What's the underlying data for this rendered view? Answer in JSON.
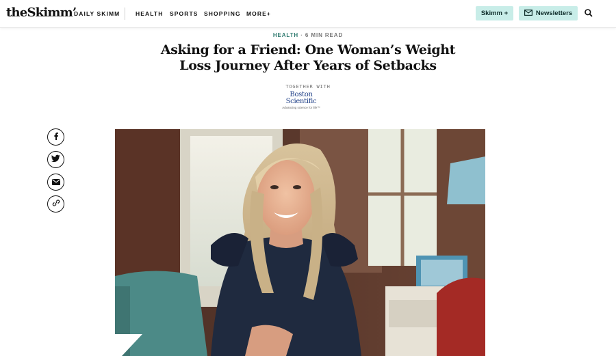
{
  "header": {
    "logo": "theSkimm’",
    "nav": [
      "DAILY SKIMM",
      "HEALTH",
      "SPORTS",
      "SHOPPING",
      "MORE+"
    ],
    "skimm_plus_label": "Skimm +",
    "newsletters_label": "Newsletters",
    "icons": {
      "search": "search-icon",
      "newsletters": "mail-icon"
    },
    "colors": {
      "accent_button_bg": "#c8ede8"
    }
  },
  "article": {
    "category": "HEALTH",
    "separator": "·",
    "read_time": "6 MIN READ",
    "title": "Asking for a Friend: One Woman’s Weight Loss Journey After Years of Setbacks",
    "sponsor_prefix": "TOGETHER WITH",
    "sponsor_name_line1": "Boston",
    "sponsor_name_line2": "Scientific",
    "sponsor_tagline": "Advancing science for life™",
    "colors": {
      "category": "#2f7a6f",
      "sponsor": "#1f3f87"
    }
  },
  "share_icons": [
    "facebook-icon",
    "twitter-icon",
    "email-icon",
    "link-icon"
  ],
  "hero": {
    "subject": "woman-smiling-photo"
  }
}
